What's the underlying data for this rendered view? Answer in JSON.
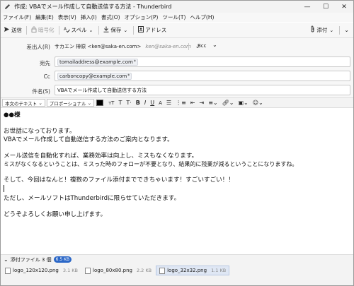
{
  "window": {
    "title": "作成: VBAでメール作成して自動送信する方法 - Thunderbird",
    "controls": {
      "minimize": "—",
      "maximize": "☐",
      "close": "✕"
    }
  },
  "menubar": {
    "items": [
      {
        "label": "ファイル(F)"
      },
      {
        "label": "編集(E)"
      },
      {
        "label": "表示(V)"
      },
      {
        "label": "挿入(I)"
      },
      {
        "label": "書式(O)"
      },
      {
        "label": "オプション(P)"
      },
      {
        "label": "ツール(T)"
      },
      {
        "label": "ヘルプ(H)"
      }
    ]
  },
  "toolbar": {
    "send": "送信",
    "encrypt": "暗号化",
    "spelling": "スペル",
    "save": "保存",
    "contacts": "アドレス",
    "attach": "添付"
  },
  "header": {
    "from_label": "差出人(R)",
    "from_value": "サカエン 榊原 <ken@saka-en.com>",
    "from_alias": "ken@saka-en.com",
    "bcc_label": "Bcc",
    "to_label": "宛先",
    "to_value": "tomailaddress@example.com",
    "cc_label": "Cc",
    "cc_value": "carboncopy@example.com",
    "subject_label": "件名(S)",
    "subject_value": "VBAでメール作成して自動送信する方法"
  },
  "format": {
    "paragraph": "本文のテキスト",
    "font": "プロポーショナル"
  },
  "body": {
    "lines": [
      "●●様",
      "",
      "お世話になっております。",
      "VBAでメール作成して自動送信する方法のご案内となります。",
      "",
      "メール送信を自動化すれば、業務効率は向上し、ミスもなくなります。",
      "ミスがなくなるということは、ミスった時のフォローが不要となり、結果的に残業が減るということになりますね。",
      "",
      "そして、今回はなんと！複数のファイル添付までできちゃいます！すごいすごい！！",
      "",
      "ただし、メールソフトはThunderbirdに限らせていただきます。",
      "",
      "どうぞよろしくお願い申し上げます。"
    ]
  },
  "attachments": {
    "title": "添付ファイル 3 個",
    "total_size": "6.5 KB",
    "items": [
      {
        "name": "logo_120x120.png",
        "size": "3.1 KB"
      },
      {
        "name": "logo_80x80.png",
        "size": "2.2 KB"
      },
      {
        "name": "logo_32x32.png",
        "size": "1.1 KB"
      }
    ]
  },
  "colors": {
    "accent": "#2b67c7",
    "text_color_swatch": "#000000"
  }
}
